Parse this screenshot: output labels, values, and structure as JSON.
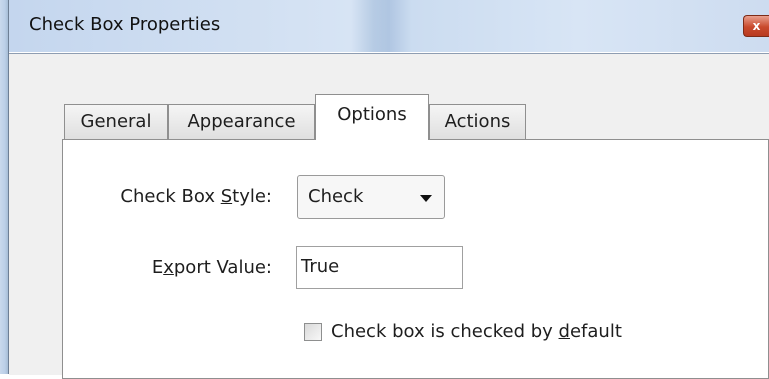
{
  "window": {
    "title": "Check Box Properties",
    "close_glyph": "x"
  },
  "tabs": [
    {
      "label": "General",
      "active": false
    },
    {
      "label": "Appearance",
      "active": false
    },
    {
      "label": "Options",
      "active": true
    },
    {
      "label": "Actions",
      "active": false
    }
  ],
  "options": {
    "style_label_pre": "Check Box ",
    "style_label_u": "S",
    "style_label_post": "tyle:",
    "style_value": "Check",
    "export_label_pre": "E",
    "export_label_u": "x",
    "export_label_post": "port Value:",
    "export_value": "True",
    "checked_default_pre": "Check box is checked by ",
    "checked_default_u": "d",
    "checked_default_post": "efault",
    "checked_default_state": false
  },
  "colors": {
    "titlebar": "#c4d6ee",
    "close_button": "#c94a2d",
    "dialog_bg": "#f0f0f0"
  }
}
